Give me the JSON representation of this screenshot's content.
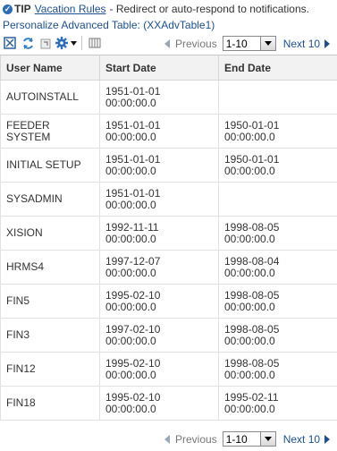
{
  "tip": {
    "label": "TIP",
    "link": "Vacation Rules",
    "text": "- Redirect or auto-respond to notifications."
  },
  "personalize_link": "Personalize Advanced Table: (XXAdvTable1)",
  "toolbar": {
    "icons": [
      "detach-icon",
      "refresh-icon",
      "export-icon",
      "settings-icon",
      "columns-icon"
    ]
  },
  "pagination": {
    "previous": "Previous",
    "range": "1-10",
    "next": "Next 10"
  },
  "table": {
    "headers": [
      "User Name",
      "Start Date",
      "End Date"
    ],
    "rows": [
      {
        "user": "AUTOINSTALL",
        "start": "1951-01-01\n00:00:00.0",
        "end": ""
      },
      {
        "user": "FEEDER\nSYSTEM",
        "start": "1951-01-01\n00:00:00.0",
        "end": "1950-01-01\n00:00:00.0"
      },
      {
        "user": "INITIAL SETUP",
        "start": "1951-01-01\n00:00:00.0",
        "end": "1950-01-01\n00:00:00.0"
      },
      {
        "user": "SYSADMIN",
        "start": "1951-01-01\n00:00:00.0",
        "end": ""
      },
      {
        "user": "XISION",
        "start": "1992-11-11\n00:00:00.0",
        "end": "1998-08-05\n00:00:00.0"
      },
      {
        "user": "HRMS4",
        "start": "1997-12-07\n00:00:00.0",
        "end": "1998-08-04\n00:00:00.0"
      },
      {
        "user": "FIN5",
        "start": "1995-02-10\n00:00:00.0",
        "end": "1998-08-05\n00:00:00.0"
      },
      {
        "user": "FIN3",
        "start": "1997-02-10\n00:00:00.0",
        "end": "1998-08-05\n00:00:00.0"
      },
      {
        "user": "FIN12",
        "start": "1995-02-10\n00:00:00.0",
        "end": "1998-08-05\n00:00:00.0"
      },
      {
        "user": "FIN18",
        "start": "1995-02-10\n00:00:00.0",
        "end": "1995-02-11\n00:00:00.0"
      }
    ]
  }
}
